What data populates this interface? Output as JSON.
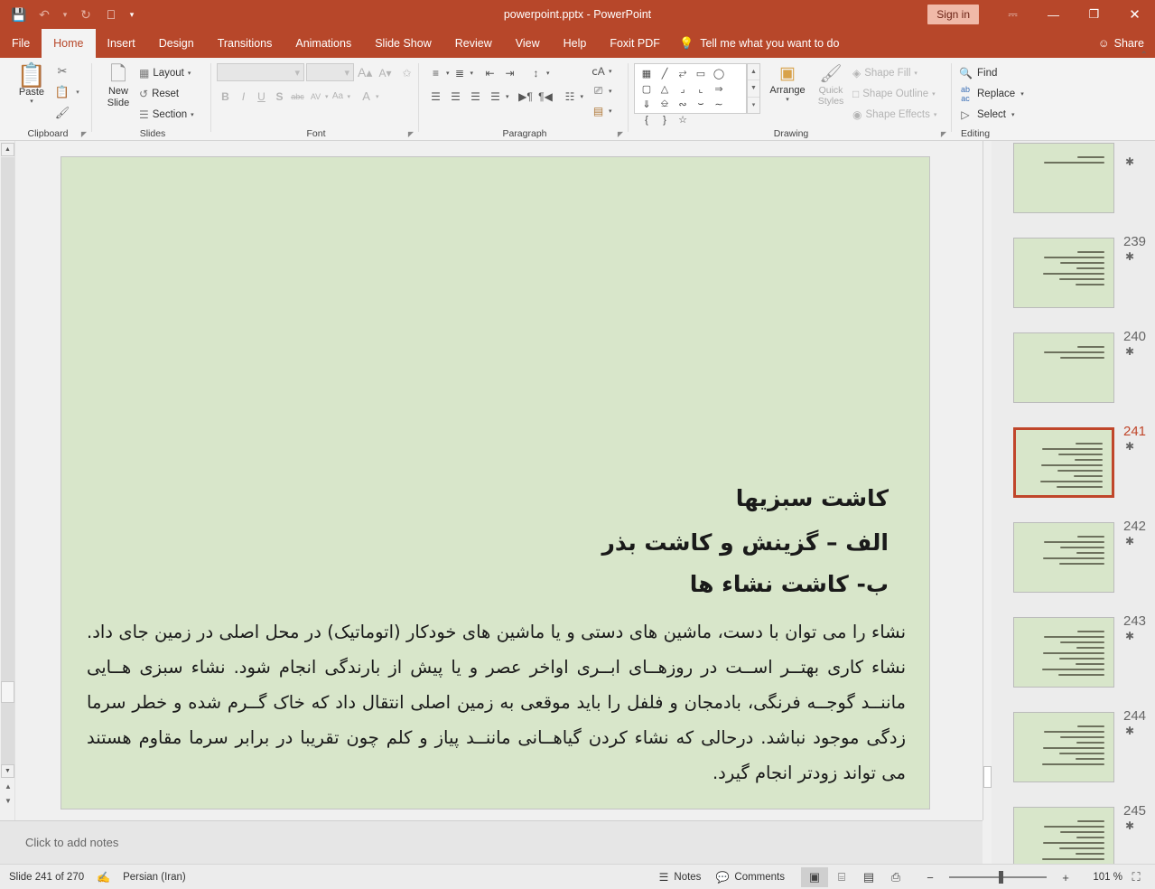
{
  "window": {
    "title": "powerpoint.pptx  -  PowerPoint",
    "signin_label": "Sign in",
    "ribbon_display_icon": "ribbon-display-options-icon",
    "minimize_icon": "minimize-icon",
    "restore_icon": "restore-icon",
    "close_icon": "close-icon"
  },
  "quick_access": [
    {
      "name": "save-icon",
      "glyph": "💾",
      "enabled": true
    },
    {
      "name": "undo-icon",
      "glyph": "↶",
      "enabled": false
    },
    {
      "name": "undo-dropdown-icon",
      "glyph": "▾",
      "enabled": false
    },
    {
      "name": "redo-icon",
      "glyph": "↻",
      "enabled": false
    },
    {
      "name": "start-slideshow-icon",
      "glyph": "▷",
      "enabled": true
    },
    {
      "name": "customize-qat-icon",
      "glyph": "▾",
      "enabled": true
    }
  ],
  "tabs": [
    {
      "label": "File",
      "active": false
    },
    {
      "label": "Home",
      "active": true
    },
    {
      "label": "Insert",
      "active": false
    },
    {
      "label": "Design",
      "active": false
    },
    {
      "label": "Transitions",
      "active": false
    },
    {
      "label": "Animations",
      "active": false
    },
    {
      "label": "Slide Show",
      "active": false
    },
    {
      "label": "Review",
      "active": false
    },
    {
      "label": "View",
      "active": false
    },
    {
      "label": "Help",
      "active": false
    },
    {
      "label": "Foxit PDF",
      "active": false
    }
  ],
  "tellme": {
    "label": "Tell me what you want to do",
    "icon": "lightbulb-icon"
  },
  "share": {
    "label": "Share",
    "icon": "share-person-icon"
  },
  "ribbon": {
    "clipboard": {
      "label": "Clipboard",
      "paste_label": "Paste",
      "cut_icon": "scissors-icon",
      "copy_icon": "copy-icon",
      "copy_caret": "▾",
      "format_painter_icon": "format-painter-icon",
      "dialog_launcher": "dialog-launcher-icon"
    },
    "slides": {
      "label": "Slides",
      "new_slide_label": "New Slide",
      "items": [
        {
          "label": "Layout",
          "icon": "layout-icon",
          "caret": "▾"
        },
        {
          "label": "Reset",
          "icon": "reset-icon",
          "caret": ""
        },
        {
          "label": "Section",
          "icon": "section-icon",
          "caret": "▾"
        }
      ]
    },
    "font": {
      "label": "Font",
      "font_name_value": "",
      "font_size_value": "",
      "grow_font": "A",
      "shrink_font": "A",
      "clear_formatting_icon": "clear-formatting-icon",
      "bold": "B",
      "italic": "I",
      "underline": "U",
      "shadow": "S",
      "strikethrough": "abc",
      "character_spacing": "AV",
      "change_case": "Aa",
      "font_color": "A",
      "disabled": true
    },
    "paragraph": {
      "label": "Paragraph",
      "row1": [
        "bullets-icon",
        "bullets-caret",
        "numbering-icon",
        "numbering-caret",
        "decrease-indent-icon",
        "increase-indent-icon",
        "line-spacing-icon",
        "line-spacing-caret"
      ],
      "row2": [
        "align-left-icon",
        "align-center-icon",
        "align-right-icon",
        "justify-icon",
        "justify-caret",
        "text-direction-ltr-icon",
        "text-direction-rtl-icon",
        "columns-icon",
        "columns-caret"
      ],
      "side": [
        "text-direction-icon",
        "align-text-icon",
        "convert-smartart-icon"
      ]
    },
    "drawing": {
      "label": "Drawing",
      "shapes": [
        "textbox-shape",
        "line-shape",
        "arrow-shape",
        "rectangle-shape",
        "oval-shape",
        "rounded-rectangle-shape",
        "triangle-shape",
        "elbow-connector-shape",
        "elbow-arrow-shape",
        "right-arrow-shape",
        "down-arrow-shape",
        "flowchart-shape",
        "scribble-shape",
        "curve-shape",
        "freeform-shape",
        "left-brace-shape",
        "right-brace-shape",
        "star-shape"
      ],
      "gallery_up": "▲",
      "gallery_down": "▼",
      "gallery_more": "▾",
      "arrange_label": "Arrange",
      "quick_styles_label": "Quick Styles",
      "items": [
        {
          "label": "Shape Fill",
          "icon": "shape-fill-icon",
          "caret": "▾"
        },
        {
          "label": "Shape Outline",
          "icon": "shape-outline-icon",
          "caret": "▾"
        },
        {
          "label": "Shape Effects",
          "icon": "shape-effects-icon",
          "caret": "▾"
        }
      ],
      "dialog_launcher": "dialog-launcher-icon"
    },
    "editing": {
      "label": "Editing",
      "items": [
        {
          "label": "Find",
          "icon": "magnifier-icon",
          "caret": ""
        },
        {
          "label": "Replace",
          "icon": "replace-icon",
          "caret": "▾"
        },
        {
          "label": "Select",
          "icon": "select-cursor-icon",
          "caret": "▾"
        }
      ]
    },
    "collapse_icon": "⌃"
  },
  "slide": {
    "background_color": "#d8e6ca",
    "headings": [
      "کاشت سبزیها",
      "الف – گزینش و کاشت بذر",
      "ب- کاشت نشاء ها"
    ],
    "body": "نشاء را می توان با دست، ماشین های دستی و یا ماشین های خودکار (اتوماتیک) در محل اصلی در زمین جای داد. نشاء کاری بهتــر اســت در روزهــای ابــری اواخر عصر و یا پیش از بارندگی انجام شود. نشاء سبزی هــایی ماننــد گوجــه فرنگی، بادمجان و فلفل را باید موقعی به زمین اصلی انتقال داد که خاک گــرم شده و خطر سرما زدگی موجود نباشد. درحالی که نشاء کردن گیاهــانی ماننــد پیاز و کلم چون تقریبا در برابر سرما مقاوم هستند می تواند زودتر انجام گیرد."
  },
  "notes": {
    "placeholder": "Click to add notes"
  },
  "thumbnails": [
    {
      "number": "",
      "selected": false,
      "star": "✱",
      "lines": 2
    },
    {
      "number": "239",
      "selected": false,
      "star": "✱",
      "lines": 7
    },
    {
      "number": "240",
      "selected": false,
      "star": "✱",
      "lines": 3
    },
    {
      "number": "241",
      "selected": true,
      "star": "✱",
      "lines": 9
    },
    {
      "number": "242",
      "selected": false,
      "star": "✱",
      "lines": 6
    },
    {
      "number": "243",
      "selected": false,
      "star": "✱",
      "lines": 9
    },
    {
      "number": "244",
      "selected": false,
      "star": "✱",
      "lines": 8
    },
    {
      "number": "245",
      "selected": false,
      "star": "✱",
      "lines": 9
    }
  ],
  "status": {
    "slide_counter": "Slide 241 of 270",
    "accessibility_icon": "accessibility-check-icon",
    "language": "Persian (Iran)",
    "notes_label": "Notes",
    "notes_icon": "notes-icon",
    "comments_label": "Comments",
    "comments_icon": "comment-bubble-icon",
    "views": [
      {
        "name": "normal-view-button",
        "icon": "▣",
        "active": true
      },
      {
        "name": "slide-sorter-view-button",
        "icon": "⌸",
        "active": false
      },
      {
        "name": "reading-view-button",
        "icon": "▤",
        "active": false
      },
      {
        "name": "slideshow-view-button",
        "icon": "⎙",
        "active": false
      }
    ],
    "zoom_out": "−",
    "zoom_in": "+",
    "zoom_level": "101 %",
    "fit_to_window_icon": "fit-slide-icon"
  },
  "colors": {
    "accent": "#b7472a",
    "selected_thumb_border": "#c0462a",
    "slide_bg": "#d8e6ca"
  }
}
